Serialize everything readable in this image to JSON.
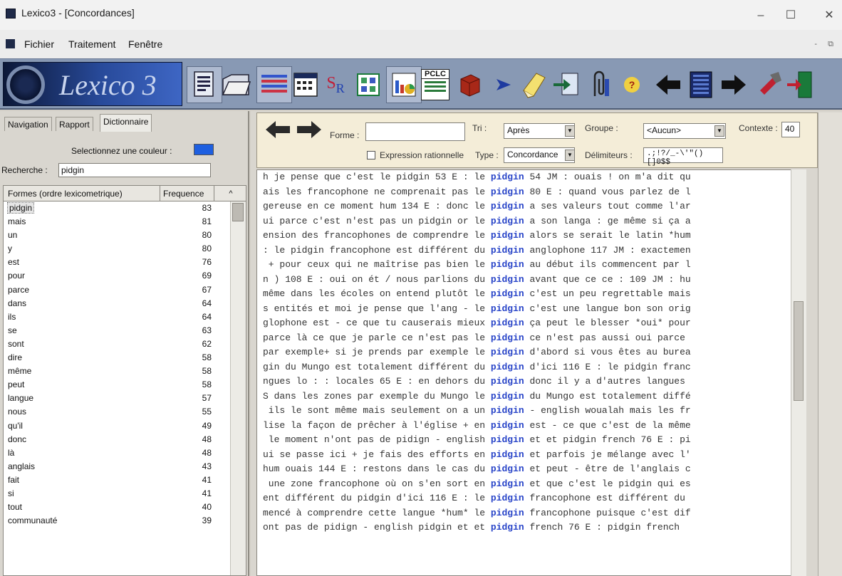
{
  "window": {
    "title": "Lexico3 - [Concordances]",
    "controls": [
      "–",
      "☐",
      "✕"
    ]
  },
  "menu": {
    "items": [
      "Fichier",
      "Traitement",
      "Fenêtre"
    ]
  },
  "toolbar": {
    "logo_text": "Lexico 3",
    "buttons": [
      "segmentation",
      "open-folder",
      "partition",
      "calendar",
      "s-r",
      "grid",
      "chart",
      "pclc",
      "cube",
      "arrow-right",
      "edit-pencil",
      "export",
      "paperclip",
      "help",
      "back-arrow",
      "grid-arrow",
      "forward-arrow",
      "close-door"
    ],
    "pclc_label": "PCLC",
    "s_label": "S",
    "r_label": "R",
    "help_label": "?"
  },
  "left_panel": {
    "tabs": [
      "Navigation",
      "Rapport",
      "Dictionnaire"
    ],
    "active_tab": "Dictionnaire",
    "color_label": "Selectionnez une couleur :",
    "color_value": "#1e5fe0",
    "search_label": "Recherche :",
    "search_value": "pidgin",
    "table": {
      "col_form": "Formes (ordre lexicometrique)",
      "col_freq": "Frequence",
      "sort_glyph": "^",
      "rows": [
        {
          "form": "pidgin",
          "freq": "83"
        },
        {
          "form": "mais",
          "freq": "81"
        },
        {
          "form": "un",
          "freq": "80"
        },
        {
          "form": "y",
          "freq": "80"
        },
        {
          "form": "est",
          "freq": "76"
        },
        {
          "form": "pour",
          "freq": "69"
        },
        {
          "form": "parce",
          "freq": "67"
        },
        {
          "form": "dans",
          "freq": "64"
        },
        {
          "form": "ils",
          "freq": "64"
        },
        {
          "form": "se",
          "freq": "63"
        },
        {
          "form": "sont",
          "freq": "62"
        },
        {
          "form": "dire",
          "freq": "58"
        },
        {
          "form": "même",
          "freq": "58"
        },
        {
          "form": "peut",
          "freq": "58"
        },
        {
          "form": "langue",
          "freq": "57"
        },
        {
          "form": "nous",
          "freq": "55"
        },
        {
          "form": "qu'il",
          "freq": "49"
        },
        {
          "form": "donc",
          "freq": "48"
        },
        {
          "form": "là",
          "freq": "48"
        },
        {
          "form": "anglais",
          "freq": "43"
        },
        {
          "form": "fait",
          "freq": "41"
        },
        {
          "form": "si",
          "freq": "41"
        },
        {
          "form": "tout",
          "freq": "40"
        },
        {
          "form": "communauté",
          "freq": "39"
        }
      ]
    }
  },
  "concordance_controls": {
    "forme_label": "Forme :",
    "forme_value": "",
    "tri_label": "Tri :",
    "tri_value": "Après",
    "groupe_label": "Groupe :",
    "groupe_value": "<Aucun>",
    "contexte_label": "Contexte :",
    "contexte_value": "40",
    "regex_label": "Expression rationnelle",
    "type_label": "Type :",
    "type_value": "Concordance",
    "delim_label": "Délimiteurs :",
    "delim_value": ".;!?/_-\\'\"()[]0$$"
  },
  "concordance": {
    "lines": [
      {
        "left": "h je pense que c'est le pidgin 53 E : le ",
        "kw": "pidgin",
        "right": " 54 JM : ouais ! on m'a dit qu"
      },
      {
        "left": "ais les francophone ne comprenait pas le ",
        "kw": "pidgin",
        "right": " 80 E : quand vous parlez de l"
      },
      {
        "left": "gereuse en ce moment hum 134 E : donc le ",
        "kw": "pidgin",
        "right": " a ses valeurs tout comme l'ar"
      },
      {
        "left": "ui parce c'est n'est pas un pidgin or le ",
        "kw": "pidgin",
        "right": " a son langa : ge même si ça a"
      },
      {
        "left": "ension des francophones de comprendre le ",
        "kw": "pidgin",
        "right": " alors se serait le latin *hum"
      },
      {
        "left": ": le pidgin francophone est différent du ",
        "kw": "pidgin",
        "right": " anglophone 117 JM : exactemen"
      },
      {
        "left": " + pour ceux qui ne maîtrise pas bien le ",
        "kw": "pidgin",
        "right": " au début ils commencent par l"
      },
      {
        "left": "n ) 108 E : oui on ét / nous parlions du ",
        "kw": "pidgin",
        "right": " avant que ce ce : 109 JM : hu"
      },
      {
        "left": "même dans les écoles on entend plutôt le ",
        "kw": "pidgin",
        "right": " c'est un peu regrettable mais"
      },
      {
        "left": "s entités et moi je pense que l'ang - le ",
        "kw": "pidgin",
        "right": " c'est une langue bon son orig"
      },
      {
        "left": "glophone est - ce que tu causerais mieux ",
        "kw": "pidgin",
        "right": " ça peut le blesser *oui* pour"
      },
      {
        "left": "parce là ce que je parle ce n'est pas le ",
        "kw": "pidgin",
        "right": " ce n'est pas aussi oui parce "
      },
      {
        "left": "par exemple+ si je prends par exemple le ",
        "kw": "pidgin",
        "right": " d'abord si vous êtes au burea"
      },
      {
        "left": "gin du Mungo est totalement différent du ",
        "kw": "pidgin",
        "right": " d'ici 116 E : le pidgin franc"
      },
      {
        "left": "ngues lo : : locales 65 E : en dehors du ",
        "kw": "pidgin",
        "right": " donc il y a d'autres langues "
      },
      {
        "left": "S dans les zones par exemple du Mungo le ",
        "kw": "pidgin",
        "right": " du Mungo est totalement diffé"
      },
      {
        "left": " ils le sont même mais seulement on a un ",
        "kw": "pidgin",
        "right": " - english woualah mais les fr"
      },
      {
        "left": "lise la façon de prêcher à l'église + en ",
        "kw": "pidgin",
        "right": " est - ce que c'est de la même"
      },
      {
        "left": " le moment n'ont pas de pidign - english ",
        "kw": "pidgin",
        "right": " et et pidgin french 76 E : pi"
      },
      {
        "left": "ui se passe ici + je fais des efforts en ",
        "kw": "pidgin",
        "right": " et parfois je mélange avec l'"
      },
      {
        "left": "hum ouais 144 E : restons dans le cas du ",
        "kw": "pidgin",
        "right": " et peut - être de l'anglais c"
      },
      {
        "left": " une zone francophone où on s'en sort en ",
        "kw": "pidgin",
        "right": " et que c'est le pidgin qui es"
      },
      {
        "left": "ent différent du pidgin d'ici 116 E : le ",
        "kw": "pidgin",
        "right": " francophone est différent du "
      },
      {
        "left": "mencé à comprendre cette langue *hum* le ",
        "kw": "pidgin",
        "right": " francophone puisque c'est dif"
      },
      {
        "left": "ont pas de pidign - english pidgin et et ",
        "kw": "pidgin",
        "right": " french 76 E : pidgin french "
      }
    ]
  },
  "colors": {
    "keyword": "#2844c8",
    "toolbar_bg": "#8899b4",
    "control_bar_bg": "#f4edd8"
  }
}
